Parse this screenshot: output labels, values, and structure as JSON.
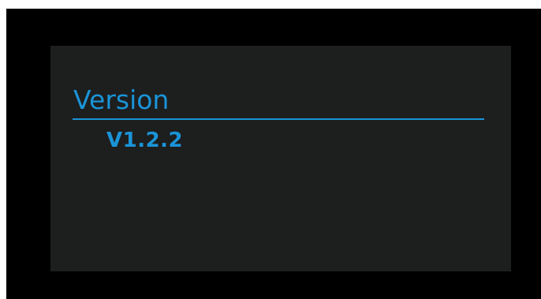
{
  "screen": {
    "title": "Version",
    "version_value": "V1.2.2"
  },
  "colors": {
    "accent": "#1a94d8",
    "panel_background": "#1d1e1e",
    "frame_background": "#000000"
  }
}
